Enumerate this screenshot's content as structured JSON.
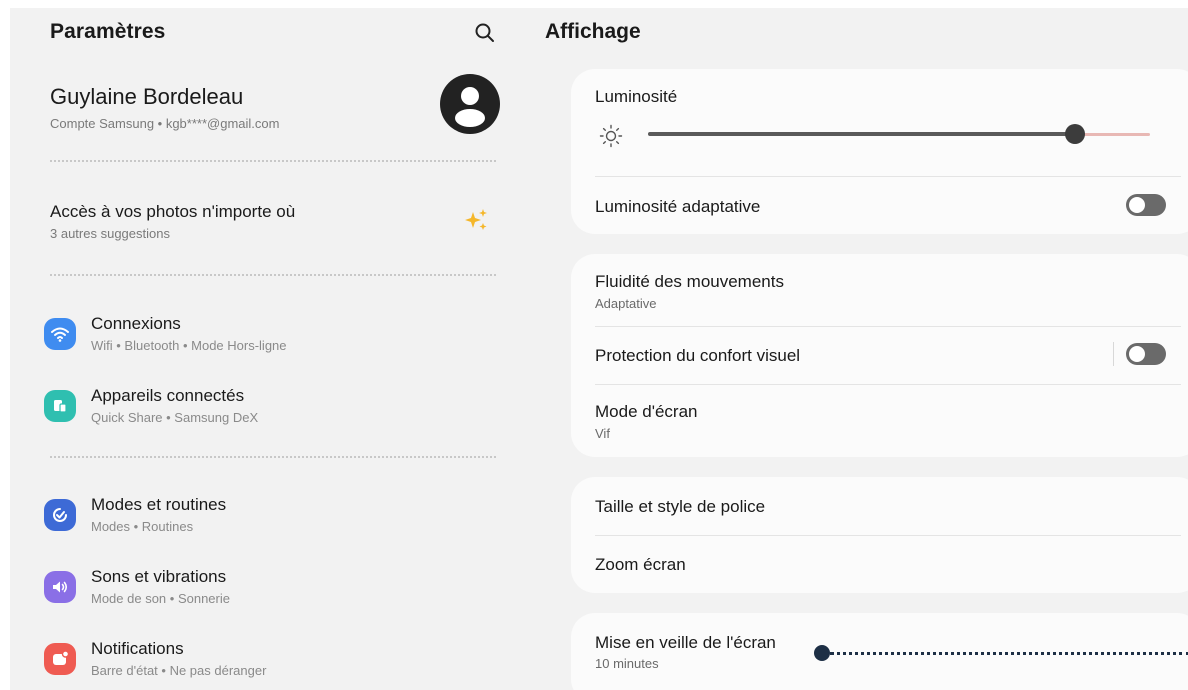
{
  "left": {
    "title": "Paramètres",
    "search_icon": "search-icon",
    "account": {
      "name": "Guylaine Bordeleau",
      "sub": "Compte Samsung • kgb****@gmail.com"
    },
    "suggestion": {
      "title": "Accès à vos photos n'importe où",
      "sub": "3 autres suggestions"
    },
    "items": [
      {
        "label": "Connexions",
        "sub": "Wifi • Bluetooth • Mode Hors-ligne",
        "icon": "wifi-icon",
        "color": "#3f8cf0"
      },
      {
        "label": "Appareils connectés",
        "sub": "Quick Share • Samsung DeX",
        "icon": "devices-icon",
        "color": "#2fbfb0"
      },
      {
        "label": "Modes et routines",
        "sub": "Modes • Routines",
        "icon": "modes-icon",
        "color": "#3d6ad6"
      },
      {
        "label": "Sons et vibrations",
        "sub": "Mode de son • Sonnerie",
        "icon": "sound-icon",
        "color": "#8a6fe6"
      },
      {
        "label": "Notifications",
        "sub": "Barre d'état • Ne pas déranger",
        "icon": "notification-icon",
        "color": "#ef5b52"
      }
    ]
  },
  "right": {
    "title": "Affichage",
    "brightness": {
      "label": "Luminosité",
      "level": 0.85
    },
    "adaptive_brightness": {
      "label": "Luminosité adaptative",
      "on": false
    },
    "motion": {
      "label": "Fluidité des mouvements",
      "value": "Adaptative"
    },
    "eye_comfort": {
      "label": "Protection du confort visuel",
      "on": false
    },
    "screen_mode": {
      "label": "Mode d'écran",
      "value": "Vif"
    },
    "font": {
      "label": "Taille et style de police"
    },
    "zoom": {
      "label": "Zoom écran"
    },
    "timeout": {
      "label": "Mise en veille de l'écran",
      "value": "10 minutes"
    }
  },
  "colors": {
    "background": "#f2f2f2",
    "card": "#fbfbfb",
    "accent_slider_rest": "#e8b8b4",
    "pointer": "#1d2f45"
  }
}
